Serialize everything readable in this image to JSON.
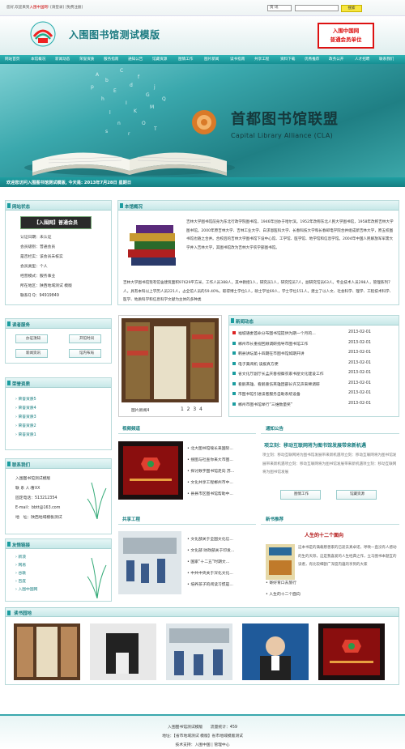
{
  "top": {
    "welcome_a": "您好,欢迎来到",
    "welcome_b": "入围中国网",
    "welcome_c": "! [请登录] [免费注册]",
    "search_type": "资 讯",
    "search_btn": "搜索"
  },
  "header": {
    "title": "入围图书馆测试模版",
    "badge_line1": "入围中国网",
    "badge_line2": "普通会员单位"
  },
  "nav": [
    "网站首页",
    "本馆概况",
    "新闻动态",
    "荣誉资质",
    "服务指南",
    "通知公告",
    "馆藏资源",
    "图情工作",
    "图片新闻",
    "读书指南",
    "共享工程",
    "资料下载",
    "优秀推荐",
    "政务公开",
    "人才招聘",
    "联系我们"
  ],
  "banner": {
    "title": "首都图书馆联盟",
    "subtitle": "Capital Library Alliance (CLA)"
  },
  "greeting": "欢迎您访问入围图书馆测试模版, 今天是: 2013年7月28日 星期日",
  "status": {
    "title": "网站状态",
    "card": "【入围网】普通会员",
    "rows": [
      "认证日期：未认证",
      "会员级别：普通会员",
      "是否栏实：该会员未核实",
      "会员类型：个人",
      "经营模式：服务事业",
      "所在地区：陕西地域测试 模版",
      "联系Q Q：94919849"
    ]
  },
  "reader": {
    "title": "读者服务",
    "btns": [
      "办证须知",
      "开馆时间",
      "新闻资讯",
      "馆内布局"
    ]
  },
  "honors": {
    "title": "荣誉资质",
    "items": [
      "荣誉资质5",
      "荣誉资质4",
      "荣誉资质3",
      "荣誉资质2",
      "荣誉资质1"
    ]
  },
  "contact": {
    "title": "联系我们",
    "rows": [
      "入围图书馆测试模版",
      "联 系 人:曹XX",
      "固定电话：513212354",
      "E-mail：bbtt@163.com",
      "地　址：陕西地域模板测试"
    ]
  },
  "links": {
    "title": "友情链接",
    "items": [
      "新浪",
      "网易",
      "谷歌",
      "百度",
      "入围中国网"
    ]
  },
  "about": {
    "title": "本馆概况",
    "p1": "吉林大学图书馆前身为东北行政学院图书馆，1946年创办于哈尔滨。1952年改称东北人民大学图书馆，1958年改称吉林大学图书馆。2000年原吉林大学、吉林工业大学、白求恩医科大学、长春科技大学和长春邮电学院合并组成新吉林大学，原五校图书馆也随之合并。合校后的吉林大学图书馆下设中心馆、工学馆、医学馆、地学馆和信息学馆。2004年中国人民解放军军需大学并入吉林大学，其图书馆改为吉林大学农学部图书馆。",
    "p2": "吉林大学图书馆现有馆舍建筑面积97629平方米，工作人员388人，其中教授1人，研究员1人，研究馆员7人，副研究馆员63人。专业技术人员298人，管理系列7人。具有本科以上学历人员221人，占全馆人员的59.40%。取得博士学位1人，硕士学位69人，学士学位151人。建立了以人文、社会科学、理学、工程技术科学、医学、地质科学和信息科学文献为主体的多种类"
  },
  "picnews": {
    "label": "图片新闻4",
    "pages": [
      "1",
      "2",
      "3",
      "4"
    ]
  },
  "news": {
    "title": "新闻动态",
    "items": [
      {
        "t": "福城语委首命分布图书馆提供为期一个月的...",
        "d": "2013-02-01"
      },
      {
        "t": "郴州市长重视回顾调研指导市图书馆工作",
        "d": "2013-02-01"
      },
      {
        "t": "韩县讲坛第十四期在市图书馆如期开讲",
        "d": "2013-02-01"
      },
      {
        "t": "电子美阅机 读报真方便",
        "d": "2013-02-01"
      },
      {
        "t": "省文化厅副厅长孟庆春视察农家书屋文化建设工作",
        "d": "2013-02-01"
      },
      {
        "t": "看鹅英雄、看鹅重伤英雄团部长许又声来稀调研",
        "d": "2013-02-01"
      },
      {
        "t": "市图书馆引进读者服务自助系统设备",
        "d": "2013-02-01"
      },
      {
        "t": "郴州市图书馆举行“三维数量奖”",
        "d": "2013-02-01"
      }
    ]
  },
  "video": {
    "title": "视频频道",
    "items": [
      "北大图书馆喻长来国际...",
      "搜图与社查你来大市图...",
      "探讨数字图书馆走向 苏...",
      "文化共享工程郴州市中...",
      "县县市区图书馆帮助中..."
    ]
  },
  "notice": {
    "title": "通知公告",
    "headline": "项立刻：移动互联网将为图书馆发展带来新机遇",
    "body": "项立刻：移动互联网将为图书馆发展带来新机遇项立刻：移动互联网将为图书馆发展带来新机遇项立刻：移动互联网将为图书馆发展带来新机遇项立刻：移动互联网将为图书馆发展",
    "btn1": "图情工作",
    "btn2": "馆藏资源"
  },
  "share": {
    "title": "共享工程",
    "items": [
      "文化部关于全国文化信...",
      "文化部 财政部关于印发...",
      "国家“十二五”时期文...",
      "中共中央关于深化文化...",
      "培养孩子的阅读习惯是..."
    ]
  },
  "books": {
    "title": "新书推荐",
    "headline": "人生的十二个面向",
    "desc": "这本书是的满载慈善家的已逝去真卓诺，呼唤一直没有人感动的生的天际，这是我喜爱的人生经典之作，立马图书本题互的读者，有比较细剖广深度内蕴的享到的大家",
    "links": [
      "寄好育口去旅行",
      "人生的十二个面向"
    ]
  },
  "reading": {
    "title": "读书园地"
  },
  "footer": {
    "l1": "入围图书馆测试模版　　流量统计：459",
    "l2": "地址：【省市地域测试 模版】省市地域模版测试",
    "l3": "技术支持：入围中国 | 管理中心"
  }
}
